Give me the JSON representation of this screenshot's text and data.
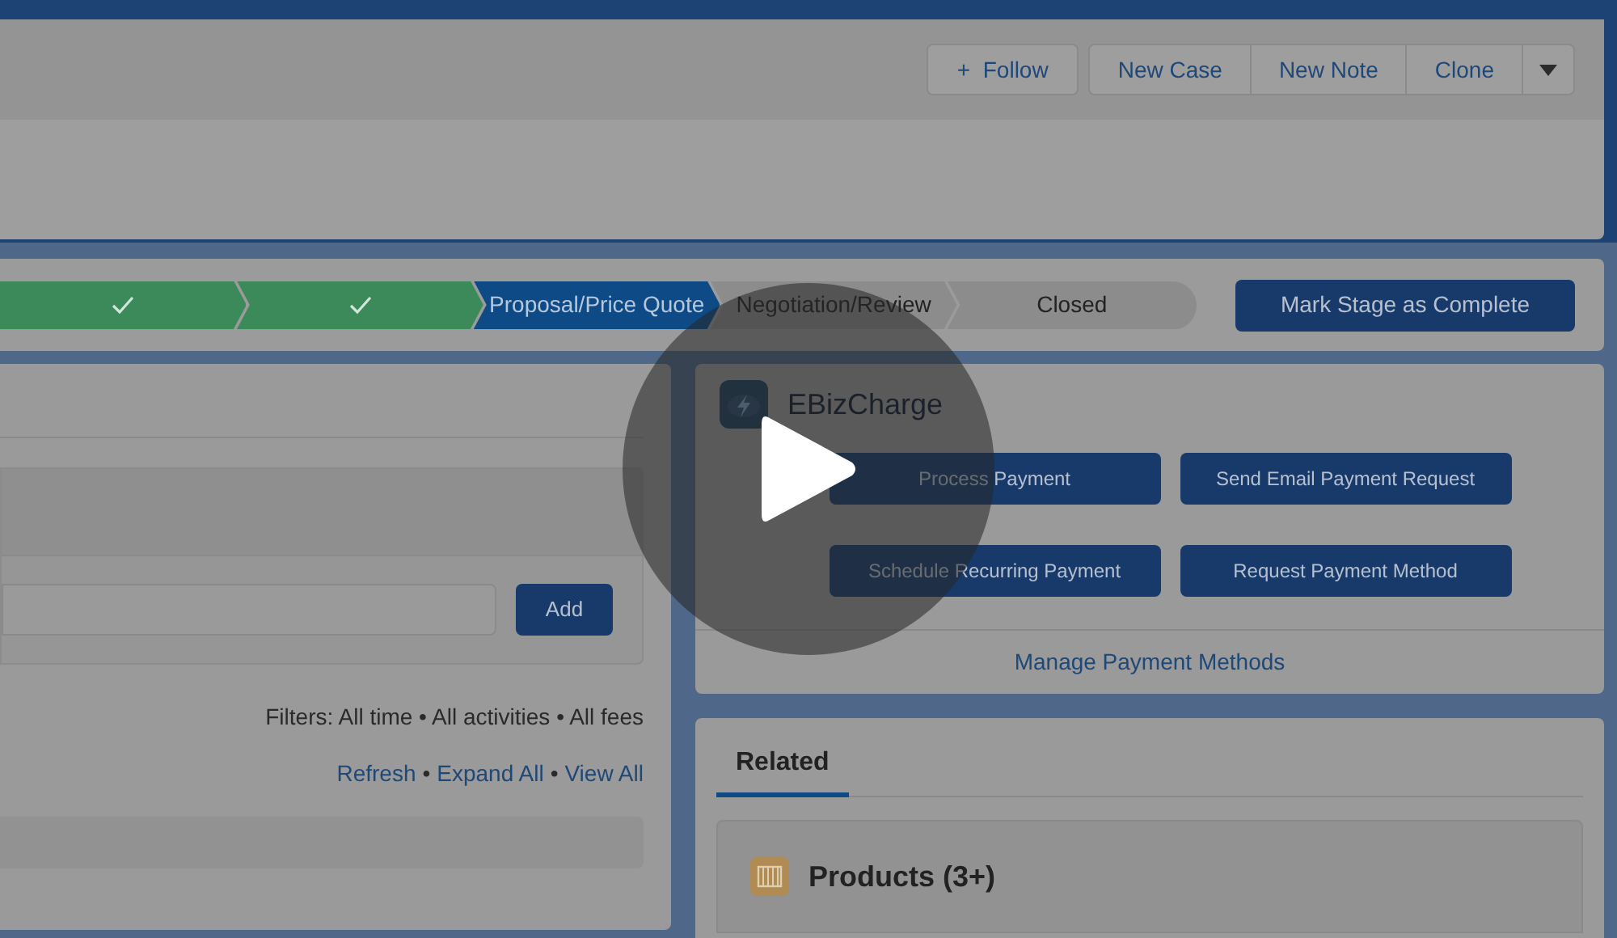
{
  "header": {
    "actions": [
      {
        "label": "Follow",
        "icon": "+",
        "kind": "follow"
      },
      {
        "label": "New Case",
        "kind": "group"
      },
      {
        "label": "New Note",
        "kind": "group"
      },
      {
        "label": "Clone",
        "kind": "group"
      },
      {
        "kind": "menu"
      }
    ]
  },
  "path": {
    "steps": [
      {
        "kind": "complete"
      },
      {
        "kind": "complete"
      },
      {
        "label": "Proposal/Price Quote",
        "kind": "current"
      },
      {
        "label": "Negotiation/Review",
        "kind": "upcoming"
      },
      {
        "label": "Closed",
        "kind": "upcoming"
      }
    ],
    "action": "Mark Stage as Complete"
  },
  "activity": {
    "add_button": "Add",
    "filters": "Filters: All time • All activities • All fees",
    "links": [
      "Refresh",
      "Expand All",
      "View All"
    ],
    "separator": "•"
  },
  "payments": {
    "title": "EBizCharge",
    "buttons": [
      "Process Payment",
      "Send Email Payment Request",
      "Schedule Recurring Payment",
      "Request Payment Method"
    ],
    "link": "Manage Payment Methods"
  },
  "related": {
    "tabs": [
      {
        "label": "Related",
        "selected": true
      }
    ],
    "lists": [
      {
        "title": "Products (3+)"
      }
    ]
  },
  "video": {
    "play": true
  }
}
